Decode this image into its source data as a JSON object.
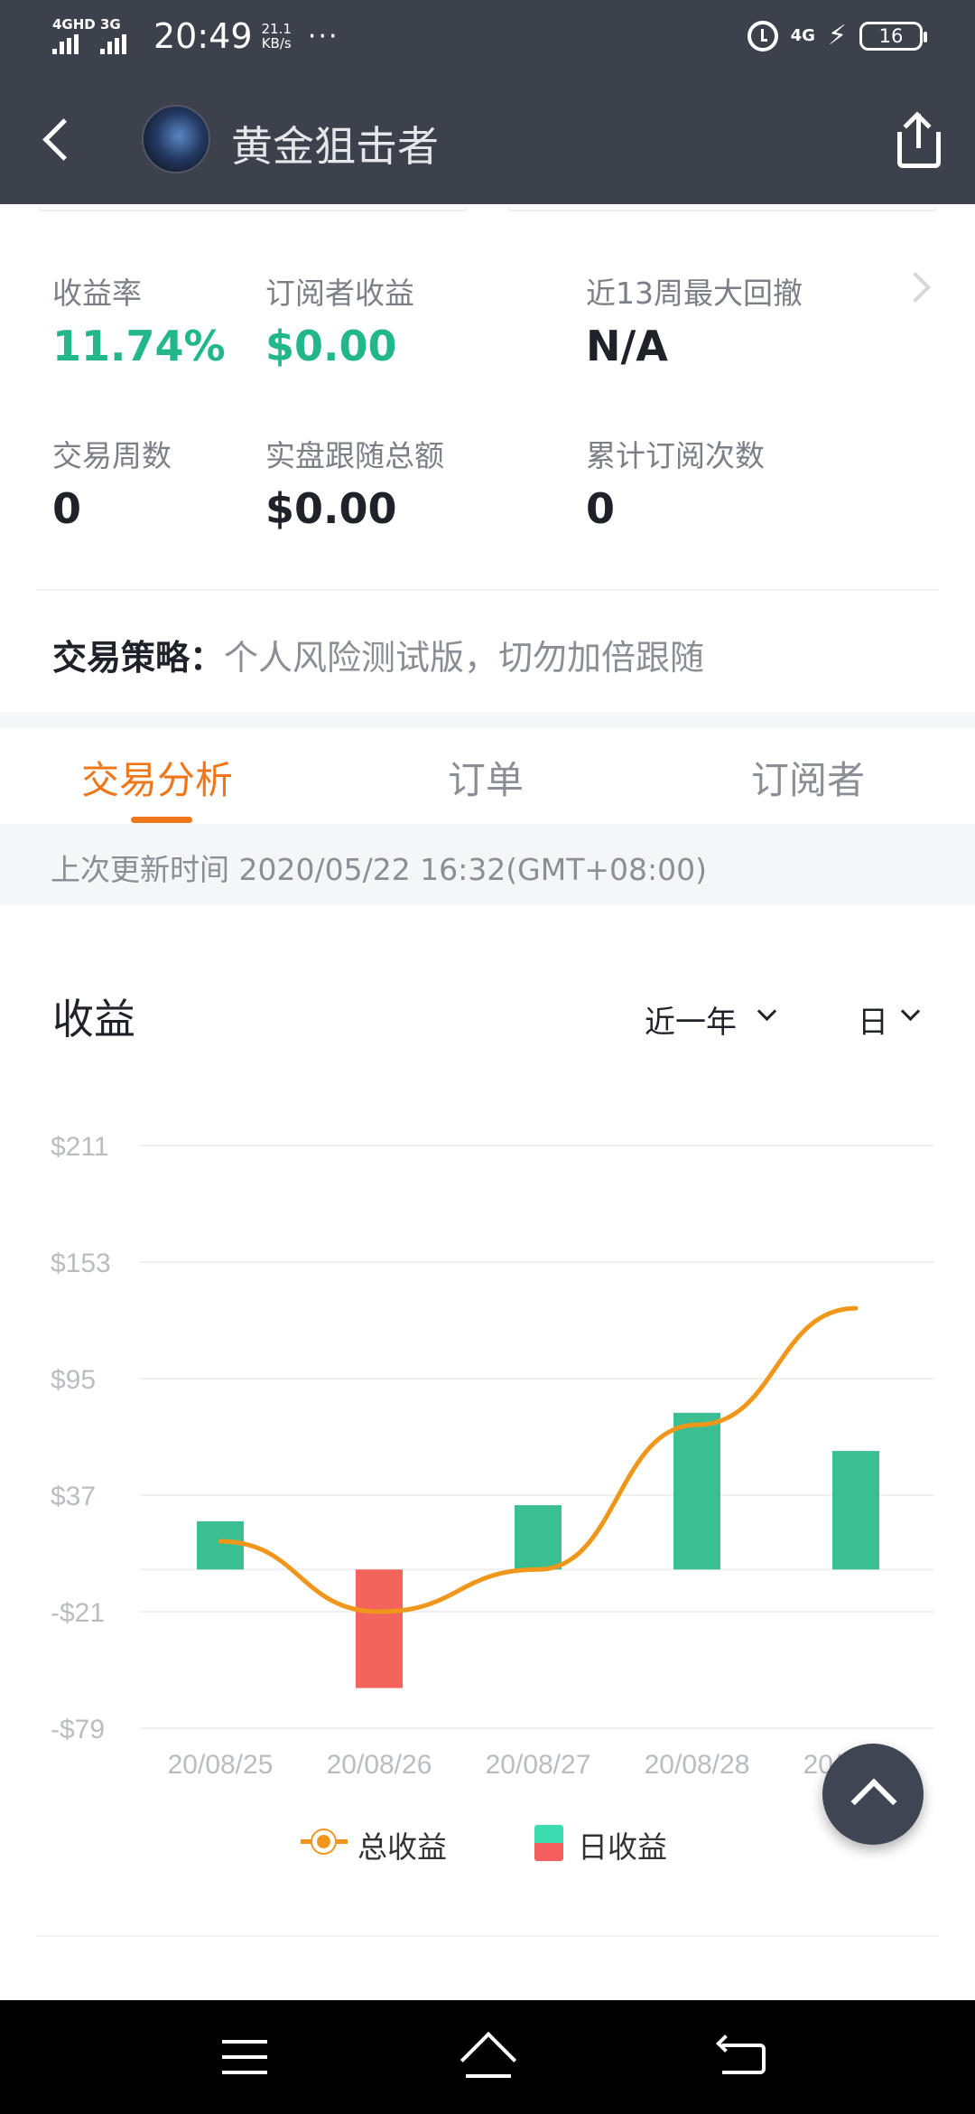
{
  "status_bar": {
    "signal1_label": "4GHD",
    "signal2_label": "3G",
    "time": "20:49",
    "speed_value": "21.1",
    "speed_unit": "KB/s",
    "more": "···",
    "network": "4G",
    "battery": "16"
  },
  "header": {
    "title": "黄金狙击者"
  },
  "stats": {
    "return_rate_label": "收益率",
    "return_rate_value": "11.74%",
    "subscriber_profit_label": "订阅者收益",
    "subscriber_profit_value": "$0.00",
    "max_drawdown_label": "近13周最大回撤",
    "max_drawdown_value": "N/A",
    "trade_weeks_label": "交易周数",
    "trade_weeks_value": "0",
    "follow_total_label": "实盘跟随总额",
    "follow_total_value": "$0.00",
    "subscription_count_label": "累计订阅次数",
    "subscription_count_value": "0"
  },
  "strategy": {
    "label": "交易策略：",
    "value": "个人风险测试版，切勿加倍跟随"
  },
  "tabs": [
    {
      "label": "交易分析",
      "active": true
    },
    {
      "label": "订单",
      "active": false
    },
    {
      "label": "订阅者",
      "active": false
    }
  ],
  "last_update": "上次更新时间 2020/05/22 16:32(GMT+08:00)",
  "chart_section": {
    "title": "收益",
    "period_select": "近一年",
    "granularity_select": "日"
  },
  "colors": {
    "accent_orange": "#f0761a",
    "positive_green": "#22b78a",
    "bar_green": "#3bbf92",
    "bar_red": "#f2645c",
    "line_orange": "#f0961a"
  },
  "chart_data": {
    "type": "bar",
    "categories": [
      "20/08/25",
      "20/08/26",
      "20/08/27",
      "20/08/28",
      "20/08/31"
    ],
    "y_tick_labels": [
      "$211",
      "$153",
      "$95",
      "$37",
      "-$21",
      "-$79"
    ],
    "y_ticks": [
      211,
      153,
      95,
      37,
      -21,
      -79
    ],
    "ylim": [
      -79,
      211
    ],
    "grid": true,
    "legend_position": "bottom-center",
    "series": [
      {
        "name": "总收益",
        "type": "line",
        "values": [
          14,
          -21,
          0,
          72,
          130
        ]
      },
      {
        "name": "日收益",
        "type": "bar",
        "values": [
          24,
          -59,
          32,
          78,
          59
        ]
      }
    ]
  },
  "icons": {
    "back": "back-arrow-icon",
    "share": "share-icon",
    "scroll_top": "chevron-up-icon",
    "nav_menu": "menu-icon",
    "nav_home": "home-icon",
    "nav_back": "return-icon"
  }
}
